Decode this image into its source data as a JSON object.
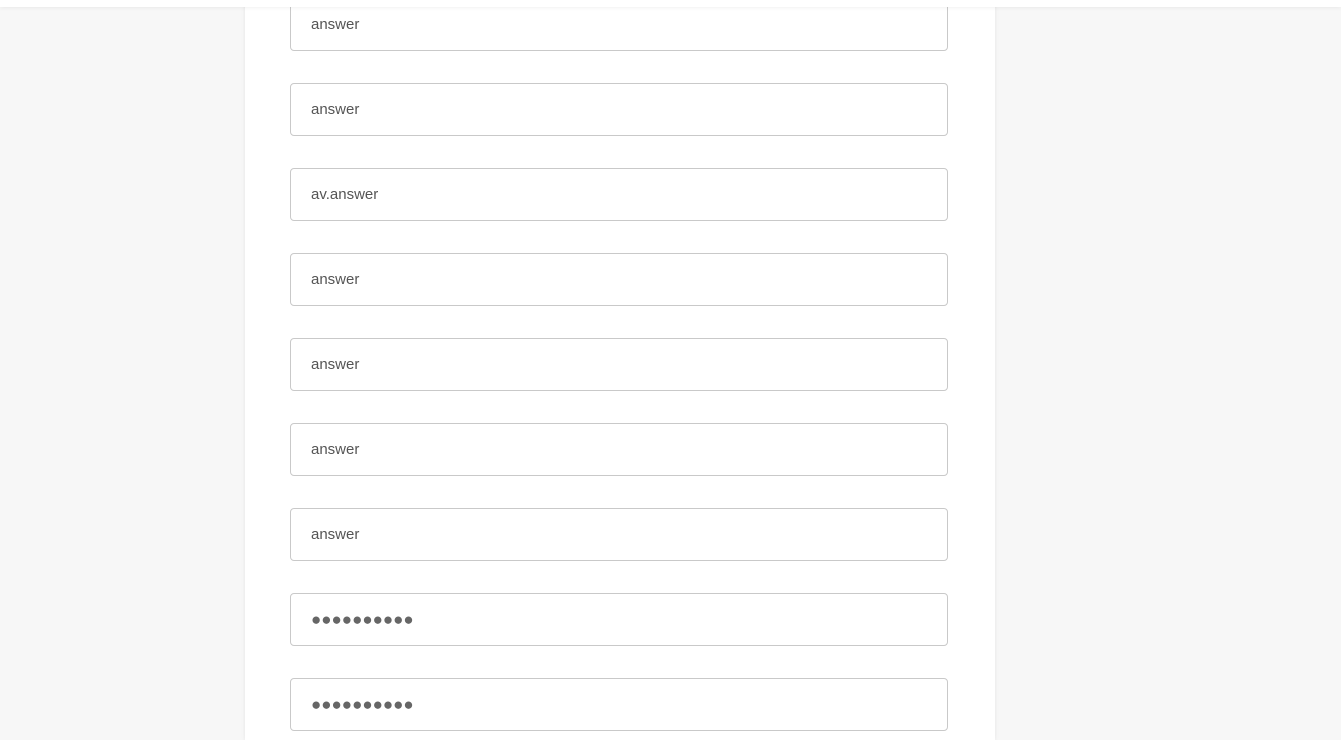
{
  "form": {
    "fields": [
      {
        "value": "answer"
      },
      {
        "value": "answer"
      },
      {
        "value": "av.answer"
      },
      {
        "value": "answer"
      },
      {
        "value": "answer"
      },
      {
        "value": "answer"
      },
      {
        "value": "answer"
      },
      {
        "value": "●●●●●●●●●●"
      },
      {
        "value": "●●●●●●●●●●"
      }
    ]
  }
}
